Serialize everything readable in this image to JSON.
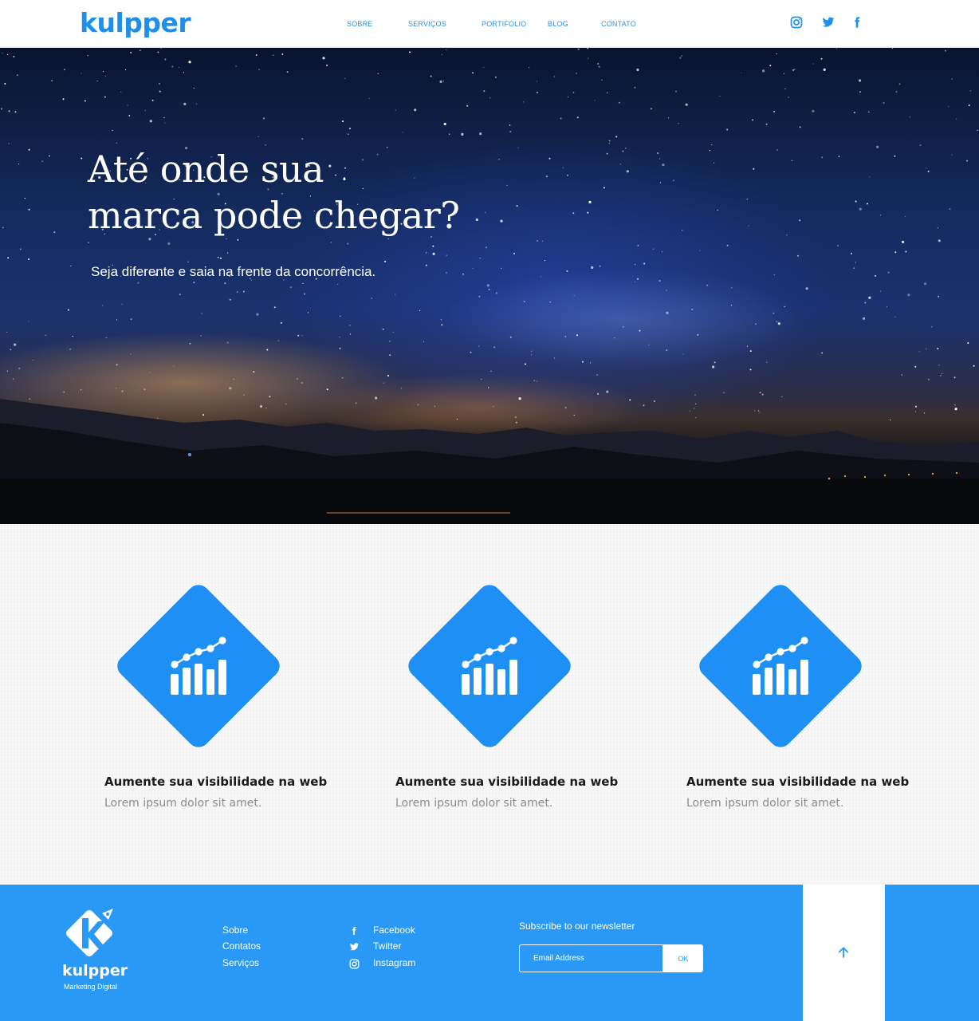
{
  "brand": {
    "name": "kulpper",
    "color": "#1e8fea"
  },
  "nav": {
    "items": [
      "SOBRE",
      "SERVIÇOS",
      "PORTIFOLIO",
      "BLOG",
      "CONTATO"
    ]
  },
  "header_social": [
    "instagram-icon",
    "twitter-icon",
    "facebook-icon"
  ],
  "hero": {
    "title_line1": "Até onde sua",
    "title_line2": "marca pode chegar?",
    "subtitle": "Seja diferente e saia na frente da concorrência."
  },
  "features": [
    {
      "icon": "growth-chart-icon",
      "title": "Aumente sua visibilidade na web",
      "text": "Lorem ipsum dolor sit amet."
    },
    {
      "icon": "growth-chart-icon",
      "title": "Aumente sua visibilidade na web",
      "text": "Lorem ipsum dolor sit amet."
    },
    {
      "icon": "growth-chart-icon",
      "title": "Aumente sua visibilidade na web",
      "text": "Lorem ipsum dolor sit amet."
    }
  ],
  "footer": {
    "logo_text": "kulpper",
    "logo_sub": "Marketing Digital",
    "links": [
      "Sobre",
      "Contatos",
      "Serviços"
    ],
    "social": [
      {
        "icon": "facebook-icon",
        "label": "Facebook"
      },
      {
        "icon": "twitter-icon",
        "label": "Twitter"
      },
      {
        "icon": "instagram-icon",
        "label": "Instagram"
      }
    ],
    "newsletter": {
      "title": "Subscribe to our newsletter",
      "placeholder": "Email Address",
      "button": "OK"
    },
    "back_to_top_icon": "arrow-up-icon",
    "background": "#2a98f5"
  }
}
